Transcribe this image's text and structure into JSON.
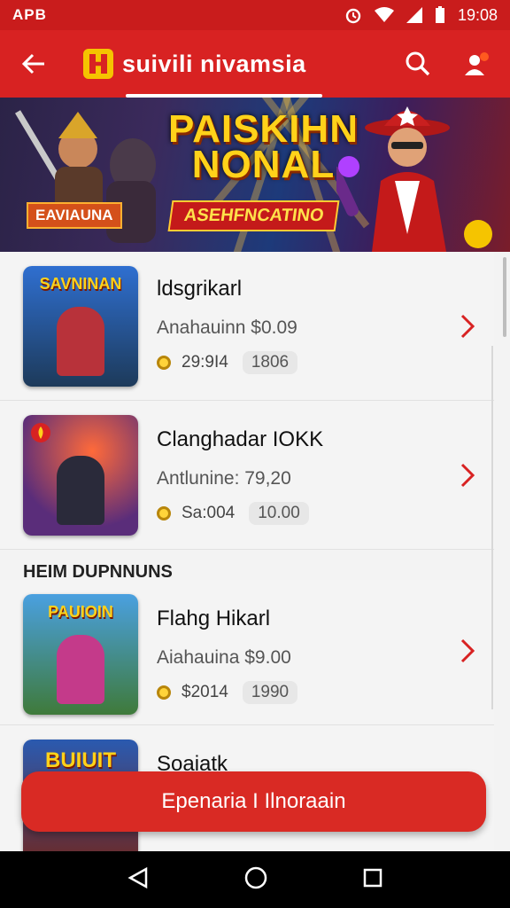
{
  "status_bar": {
    "carrier": "APB",
    "time": "19:08"
  },
  "app_bar": {
    "title": "suivili nivamsia"
  },
  "banner": {
    "title_line1": "PAISKIHN",
    "title_line2": "NONAL",
    "subtitle": "ASEHFNCATINO",
    "side_label": "EAVIAUNA"
  },
  "games": [
    {
      "thumb_title": "SAVNINAN",
      "name": "ldsgrikarl",
      "price": "Anahauinn $0.09",
      "rating": "29:9I4",
      "count": "1806",
      "color": "#3a5d9a"
    },
    {
      "thumb_title": "",
      "name": "Clanghadar IOKK",
      "price": "Antlunine: 79,20",
      "rating": "Sa:004",
      "count": "10.00",
      "color": "#5a2d7a"
    },
    {
      "thumb_title": "PAUIOIN",
      "name": "Flahg Hikarl",
      "price": "Aiahauina $9.00",
      "rating": "$2014",
      "count": "1990",
      "color": "#3f7a3a"
    },
    {
      "thumb_title": "BUIUIT",
      "name": "Soaiatk"
    }
  ],
  "section_label": "HEIM DUPNNUNS",
  "cta": {
    "label": "Epenaria I Ilnoraain"
  },
  "icons": {
    "back": "back-arrow-icon",
    "search": "search-icon",
    "profile": "profile-icon",
    "brand_color": "#d82222",
    "accent": "#f5c400"
  }
}
